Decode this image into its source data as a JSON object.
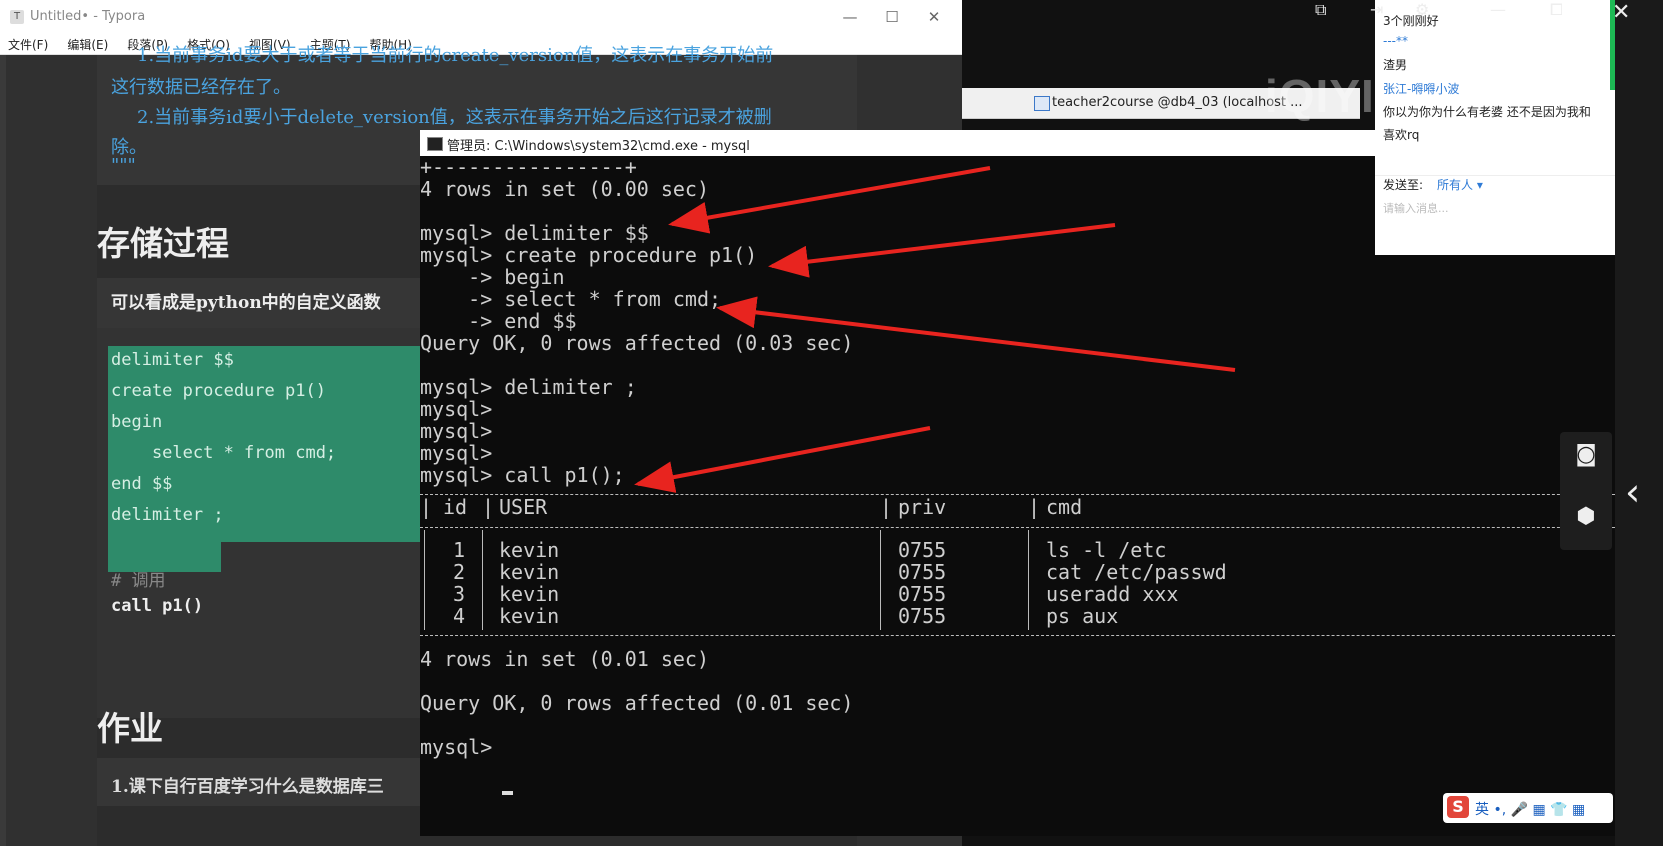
{
  "typora": {
    "title": "Untitled• - Typora",
    "menu": [
      "文件(F)",
      "编辑(E)",
      "段落(P)",
      "格式(O)",
      "视图(V)",
      "主题(T)",
      "帮助(H)"
    ],
    "quote_lines": [
      "1.当前事务id要大于或者等于当前行的create_version值，这表示在事务开始前",
      "这行数据已经存在了。",
      "2.当前事务id要小于delete_version值，这表示在事务开始之后这行记录才被删",
      "除。",
      "\"\"\""
    ],
    "heading_stored_procedure": "存储过程",
    "para_python": "可以看成是python中的自定义函数",
    "code_lines": [
      "delimiter $$",
      "create procedure p1()",
      "begin",
      "    select * from cmd;",
      "end $$",
      "delimiter ;"
    ],
    "comment": "# 调用",
    "call_line": "call p1()",
    "heading_homework": "作业",
    "homework_item": "1.课下自行百度学习什么是数据库三"
  },
  "background_tab": {
    "label": "teacher2course @db4_03 (localhost ..."
  },
  "cmd": {
    "title": "管理员: C:\\Windows\\system32\\cmd.exe - mysql",
    "lines": [
      "+----------------+",
      "4 rows in set (0.00 sec)",
      "",
      "mysql> delimiter $$",
      "mysql> create procedure p1()",
      "    -> begin",
      "    -> select * from cmd;",
      "    -> end $$",
      "Query OK, 0 rows affected (0.03 sec)",
      "",
      "mysql> delimiter ;",
      "mysql>",
      "mysql>",
      "mysql>",
      "mysql> call p1();"
    ],
    "table_header": [
      "id",
      "USER",
      "priv",
      "cmd"
    ],
    "table_rows": [
      [
        "1",
        "kevin",
        "0755",
        "ls -l /etc"
      ],
      [
        "2",
        "kevin",
        "0755",
        "cat /etc/passwd"
      ],
      [
        "3",
        "kevin",
        "0755",
        "useradd xxx"
      ],
      [
        "4",
        "kevin",
        "0755",
        "ps aux"
      ]
    ],
    "after_lines": [
      "4 rows in set (0.01 sec)",
      "",
      "Query OK, 0 rows affected (0.01 sec)",
      "",
      "mysql>"
    ]
  },
  "chat": {
    "line1": "3个刚刚好",
    "line2": "---**",
    "line3": "渣男",
    "line4": "张江-嘚嘚小波",
    "line5": "你以为你为什么有老婆 还不是因为我和",
    "line6": "喜欢rq",
    "send_to_label": "发送至:",
    "send_to_value": "所有人 ▾",
    "input_placeholder": "请输入消息..."
  },
  "watermark": "iQIYI爱奇艺",
  "ime": {
    "logo": "S",
    "text": "英 •, 🎤 ▦ 👕 ▦"
  },
  "icons": {
    "camera": "camera-icon",
    "gear_plus": "gear-plus-icon",
    "chevron": "chevron-left-icon"
  },
  "colors": {
    "code_highlight": "#2e8b6a",
    "blue_text": "#4aa3df",
    "arrow": "#e8241f"
  }
}
